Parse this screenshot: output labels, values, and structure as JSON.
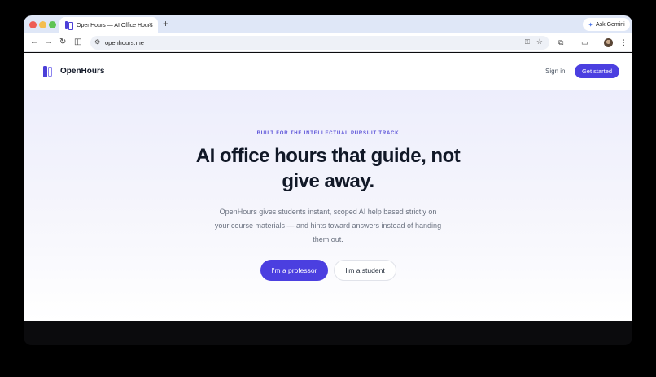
{
  "browser": {
    "tab_title": "OpenHours — AI Office Hours",
    "tab_close": "×",
    "new_tab": "+",
    "gemini_label": "Ask Gemini",
    "url": "openhours.me",
    "icons": {
      "back": "←",
      "forward": "→",
      "reload": "↻",
      "reader": "◫",
      "tune": "⚙",
      "key": "⚿",
      "bookmark": "☆",
      "extensions": "⧉",
      "cast": "▭",
      "menu": "⋮"
    }
  },
  "site": {
    "brand": "OpenHours",
    "nav": {
      "sign_in": "Sign in",
      "get_started": "Get started"
    },
    "hero": {
      "eyebrow": "BUILT FOR THE INTELLECTUAL PURSUIT TRACK",
      "headline_line1": "AI office hours that guide, not",
      "headline_line2": "give away.",
      "sub_line1": "OpenHours gives students instant, scoped AI help based strictly on",
      "sub_line2": "your course materials — and hints toward answers instead of handing",
      "sub_line3": "them out.",
      "cta_primary": "I'm a professor",
      "cta_secondary": "I'm a student"
    }
  },
  "colors": {
    "accent": "#4b3fe0",
    "eyebrow": "#5a51d8",
    "tabstrip": "#dfe7f7"
  }
}
